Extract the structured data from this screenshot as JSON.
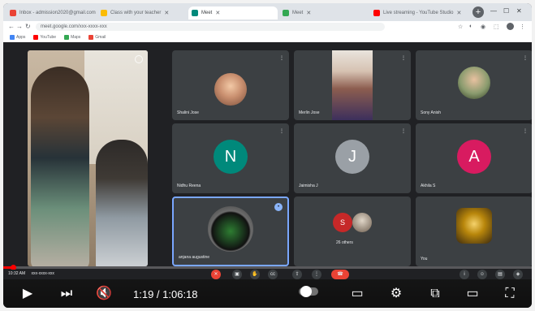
{
  "browser": {
    "tabs": [
      {
        "label": "Inbox - admission2020@gmail.com",
        "color": "#ea4335",
        "active": false
      },
      {
        "label": "Class with your teacher",
        "color": "#fbbc04",
        "active": false
      },
      {
        "label": "Meet",
        "color": "#00897b",
        "active": true
      },
      {
        "label": "Meet",
        "color": "#34a853",
        "active": false
      },
      {
        "label": "Live streaming - YouTube Studio",
        "color": "#ff0000",
        "active": false
      }
    ],
    "url": "meet.google.com/xxx-xxxx-xxx",
    "bookmarks": [
      {
        "label": "Apps",
        "color": "#4285f4"
      },
      {
        "label": "YouTube",
        "color": "#ff0000"
      },
      {
        "label": "Maps",
        "color": "#34a853"
      },
      {
        "label": "Gmail",
        "color": "#ea4335"
      }
    ]
  },
  "meet": {
    "tiles": [
      {
        "name": "Shalini Jose",
        "type": "photo",
        "color": "#c98f6f"
      },
      {
        "name": "Merlin Jose",
        "type": "video",
        "color": "#b36b5c"
      },
      {
        "name": "Sony Anish",
        "type": "photo",
        "color": "#8a9b6e"
      },
      {
        "name": "Nidhu Reena",
        "type": "letter",
        "letter": "N",
        "color": "#00897b"
      },
      {
        "name": "Jaimisha J",
        "type": "letter",
        "letter": "J",
        "color": "#9aa0a6"
      },
      {
        "name": "Akhila S",
        "type": "letter",
        "letter": "A",
        "color": "#d81b60"
      },
      {
        "name": "anjana augustine",
        "type": "ring",
        "color": "#2e7d32"
      },
      {
        "name": "26 others",
        "type": "others",
        "letter": "S",
        "color": "#c62828"
      },
      {
        "name": "You",
        "type": "logo",
        "color": "#b8860b"
      }
    ],
    "clock": "10:32 AM",
    "meeting_code": "xxx-xxxx-xxx"
  },
  "youtube": {
    "progress": 0.018,
    "time": "1:19 / 1:06:18"
  }
}
